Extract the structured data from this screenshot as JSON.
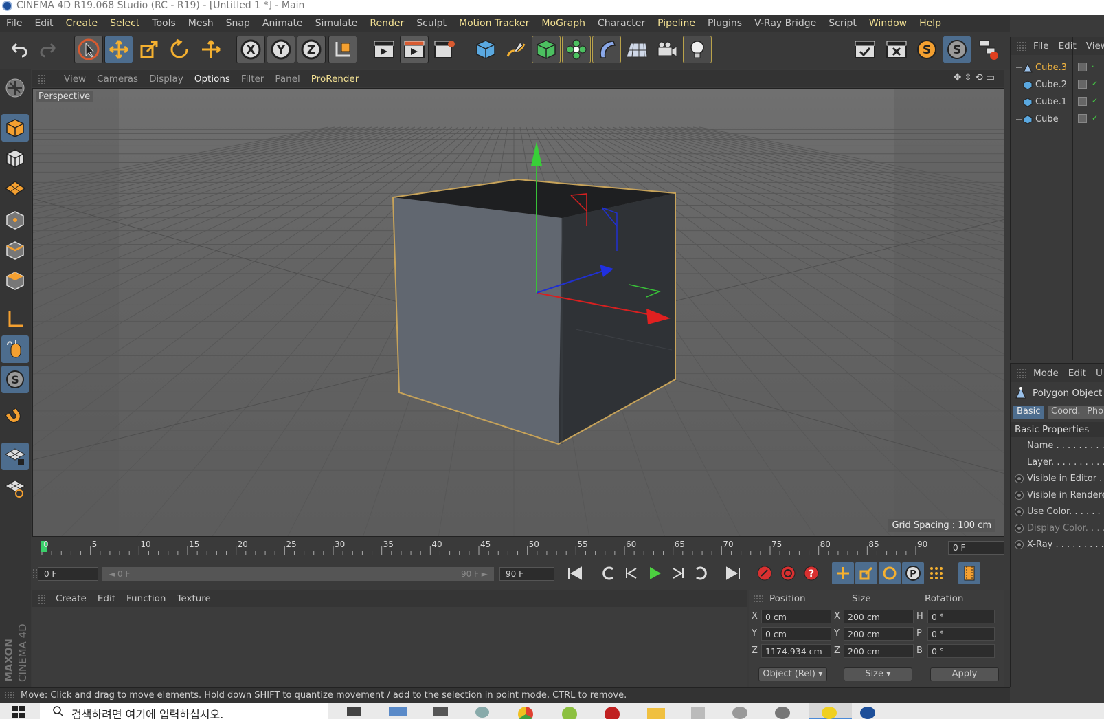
{
  "window": {
    "title": "CINEMA 4D R19.068 Studio (RC - R19) - [Untitled 1 *] - Main"
  },
  "menubar": [
    "File",
    "Edit",
    "Create",
    "Select",
    "Tools",
    "Mesh",
    "Snap",
    "Animate",
    "Simulate",
    "Render",
    "Sculpt",
    "Motion Tracker",
    "MoGraph",
    "Character",
    "Pipeline",
    "Plugins",
    "V-Ray Bridge",
    "Script",
    "Window",
    "Help"
  ],
  "menubar_highlight": [
    "Create",
    "Select",
    "Render",
    "Motion Tracker",
    "MoGraph",
    "Pipeline",
    "Window",
    "Help"
  ],
  "toolbar": {
    "axis_x": "X",
    "axis_y": "Y",
    "axis_z": "Z",
    "script_s1": "S",
    "script_s2": "S"
  },
  "viewport_menu": [
    "View",
    "Cameras",
    "Display",
    "Options",
    "Filter",
    "Panel",
    "ProRender"
  ],
  "viewport_menu_active": "Options",
  "viewport_menu_accent": "ProRender",
  "viewport": {
    "label": "Perspective",
    "grid_spacing": "Grid Spacing : 100 cm"
  },
  "timeline": {
    "ticks": [
      "0",
      "5",
      "10",
      "15",
      "20",
      "25",
      "30",
      "35",
      "40",
      "45",
      "50",
      "55",
      "60",
      "65",
      "70",
      "75",
      "80",
      "85",
      "90"
    ],
    "current_frame": "0 F"
  },
  "playbar": {
    "start": "0 F",
    "range_start": "◄ 0 F",
    "range_end": "90 F ►",
    "end": "90 F"
  },
  "material_menu": [
    "Create",
    "Edit",
    "Function",
    "Texture"
  ],
  "coords": {
    "headers": {
      "position": "Position",
      "size": "Size",
      "rotation": "Rotation"
    },
    "rows": [
      {
        "axis": "X",
        "pos": "0 cm",
        "size_axis": "X",
        "size": "200 cm",
        "rot_axis": "H",
        "rot": "0 °"
      },
      {
        "axis": "Y",
        "pos": "0 cm",
        "size_axis": "Y",
        "size": "200 cm",
        "rot_axis": "P",
        "rot": "0 °"
      },
      {
        "axis": "Z",
        "pos": "1174.934 cm",
        "size_axis": "Z",
        "size": "200 cm",
        "rot_axis": "B",
        "rot": "0 °"
      }
    ],
    "mode_select": "Object (Rel)",
    "size_select": "Size",
    "apply": "Apply"
  },
  "brand": {
    "maxon": "MAXON",
    "cinema": "CINEMA 4D"
  },
  "status": "Move: Click and drag to move elements. Hold down SHIFT to quantize movement / add to the selection in point mode, CTRL to remove.",
  "taskbar": {
    "search_placeholder": "검색하려면 여기에 입력하십시오."
  },
  "object_manager": {
    "menu": [
      "File",
      "Edit",
      "View"
    ],
    "objects": [
      {
        "name": "Cube.3",
        "selected": true,
        "icon": "polygon-object-icon"
      },
      {
        "name": "Cube.2",
        "selected": false,
        "icon": "cube-icon"
      },
      {
        "name": "Cube.1",
        "selected": false,
        "icon": "cube-icon"
      },
      {
        "name": "Cube",
        "selected": false,
        "icon": "cube-icon"
      }
    ]
  },
  "attributes": {
    "menu": [
      "Mode",
      "Edit",
      "U"
    ],
    "object_type": "Polygon Object",
    "tabs": [
      "Basic",
      "Coord.",
      "Pho"
    ],
    "section": "Basic Properties",
    "props": [
      "Name . . . . . . . . .",
      "Layer. . . . . . . . . .",
      "Visible in Editor . .",
      "Visible in Renderer",
      "Use Color. . . . . . .",
      "Display Color. . . .",
      "X-Ray . . . . . . . . ."
    ]
  },
  "colors": {
    "accent_blue": "#4d6d8e",
    "highlight_yellow": "#f2e093",
    "selection_orange": "#f2b540"
  }
}
